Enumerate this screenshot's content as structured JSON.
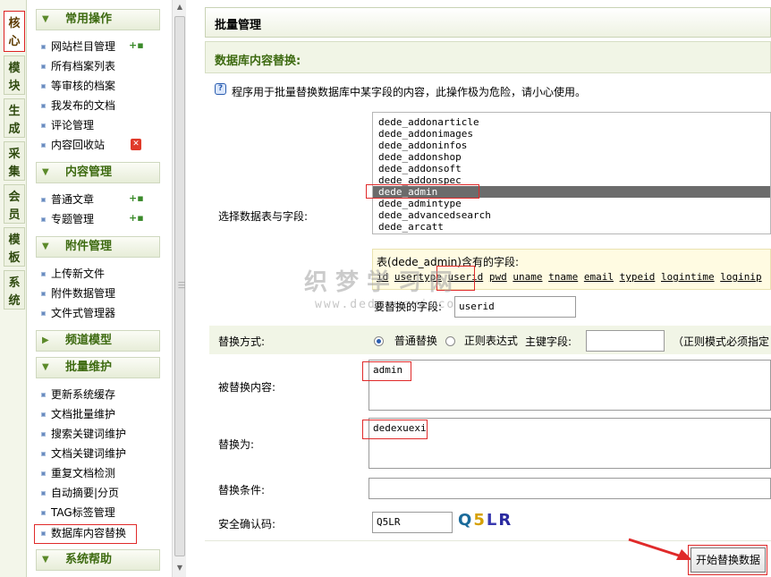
{
  "tabs": [
    "核心",
    "模块",
    "生成",
    "采集",
    "会员",
    "模板",
    "系统"
  ],
  "menu": {
    "groups": {
      "common": "常用操作",
      "content": "内容管理",
      "attach": "附件管理",
      "channel": "频道模型",
      "batch": "批量维护",
      "help": "系统帮助"
    },
    "common_items": [
      "网站栏目管理",
      "所有档案列表",
      "等审核的档案",
      "我发布的文档",
      "评论管理",
      "内容回收站"
    ],
    "content_items": [
      "普通文章",
      "专题管理"
    ],
    "attach_items": [
      "上传新文件",
      "附件数据管理",
      "文件式管理器"
    ],
    "batch_items": [
      "更新系统缓存",
      "文档批量维护",
      "搜索关键词维护",
      "文档关键词维护",
      "重复文档检测",
      "自动摘要|分页",
      "TAG标签管理",
      "数据库内容替换"
    ]
  },
  "page": {
    "title": "批量管理",
    "subtitle": "数据库内容替换:",
    "notice": "程序用于批量替换数据库中某字段的内容，此操作极为危险，请小心使用。",
    "label_select": "选择数据表与字段:",
    "tables": [
      "dede_addonarticle",
      "dede_addonimages",
      "dede_addoninfos",
      "dede_addonshop",
      "dede_addonsoft",
      "dede_addonspec",
      "dede_admin",
      "dede_admintype",
      "dede_advancedsearch",
      "dede_arcatt"
    ],
    "selected_table": "dede_admin",
    "fields_title": "表(dede_admin)含有的字段:",
    "fields": [
      "id",
      "usertype",
      "userid",
      "pwd",
      "uname",
      "tname",
      "email",
      "typeid",
      "logintime",
      "loginip"
    ],
    "label_replace_field": "要替换的字段:",
    "replace_field_value": "userid",
    "label_mode": "替换方式:",
    "mode_normal": "普通替换",
    "mode_regex": "正则表达式",
    "label_pk": "主键字段:",
    "regex_note": "（正则模式必须指定",
    "label_old": "被替换内容:",
    "old_value": "admin",
    "label_new": "替换为:",
    "new_value": "dedexuexi",
    "label_condition": "替换条件:",
    "label_captcha": "安全确认码:",
    "captcha_value": "Q5LR",
    "captcha_image_text": "Q5LR",
    "submit": "开始替换数据",
    "watermark": "织梦学习网",
    "watermark_url": "www.dedexuexi.com"
  },
  "colors": {
    "accent_green": "#3d6a10",
    "highlight_red": "#e02a2a",
    "selected_row": "#6b6b6b"
  }
}
